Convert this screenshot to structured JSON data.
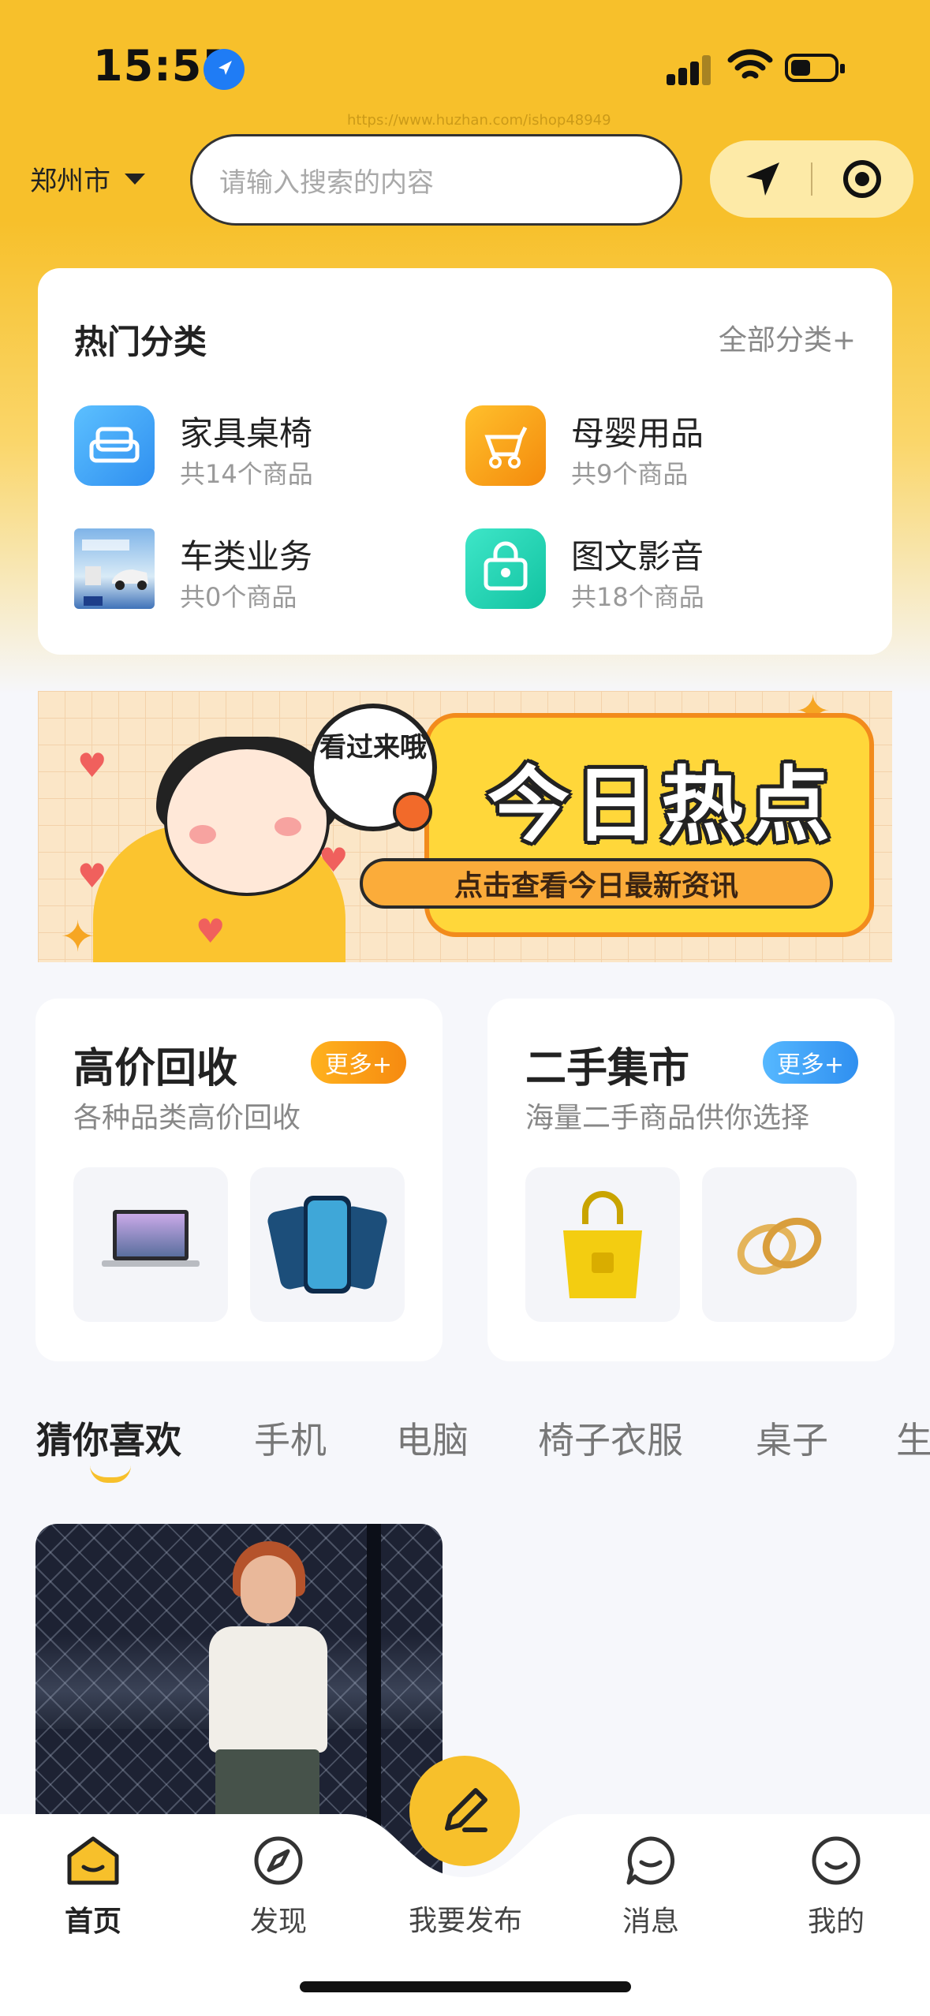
{
  "status_bar": {
    "time": "15:55",
    "url_watermark": "https://www.huzhan.com/ishop48949"
  },
  "header": {
    "city": "郑州市",
    "search_placeholder": "请输入搜索的内容"
  },
  "categories": {
    "title": "热门分类",
    "all_label": "全部分类+",
    "items": [
      {
        "name": "家具桌椅",
        "count": "共14个商品",
        "icon": "sofa-icon",
        "color": "#3aa3f5"
      },
      {
        "name": "母婴用品",
        "count": "共9个商品",
        "icon": "stroller-icon",
        "color": "#f8a21a"
      },
      {
        "name": "车类业务",
        "count": "共0个商品",
        "icon": "car-thumbnail",
        "color": "#5b9bd8"
      },
      {
        "name": "图文影音",
        "count": "共18个商品",
        "icon": "disc-bag-icon",
        "color": "#1fd3b0"
      }
    ]
  },
  "banner": {
    "bubble": "看过来哦",
    "title": "今日热点",
    "subtitle": "点击查看今日最新资讯"
  },
  "promos": [
    {
      "title": "高价回收",
      "more": "更多+",
      "subtitle": "各种品类高价回收",
      "accent": "#f8a21a",
      "images": [
        "laptop-image",
        "phones-image"
      ]
    },
    {
      "title": "二手集市",
      "more": "更多+",
      "subtitle": "海量二手商品供你选择",
      "accent": "#3aa3f5",
      "images": [
        "handbag-image",
        "rings-image"
      ]
    }
  ],
  "tabs": [
    "猜你喜欢",
    "手机",
    "电脑",
    "椅子衣服",
    "桌子",
    "生"
  ],
  "tabbar": {
    "items": [
      "首页",
      "发现",
      "我要发布",
      "消息",
      "我的"
    ],
    "active": "首页"
  },
  "colors": {
    "brand": "#f7c02b",
    "page_bg": "#f6f7fb"
  }
}
